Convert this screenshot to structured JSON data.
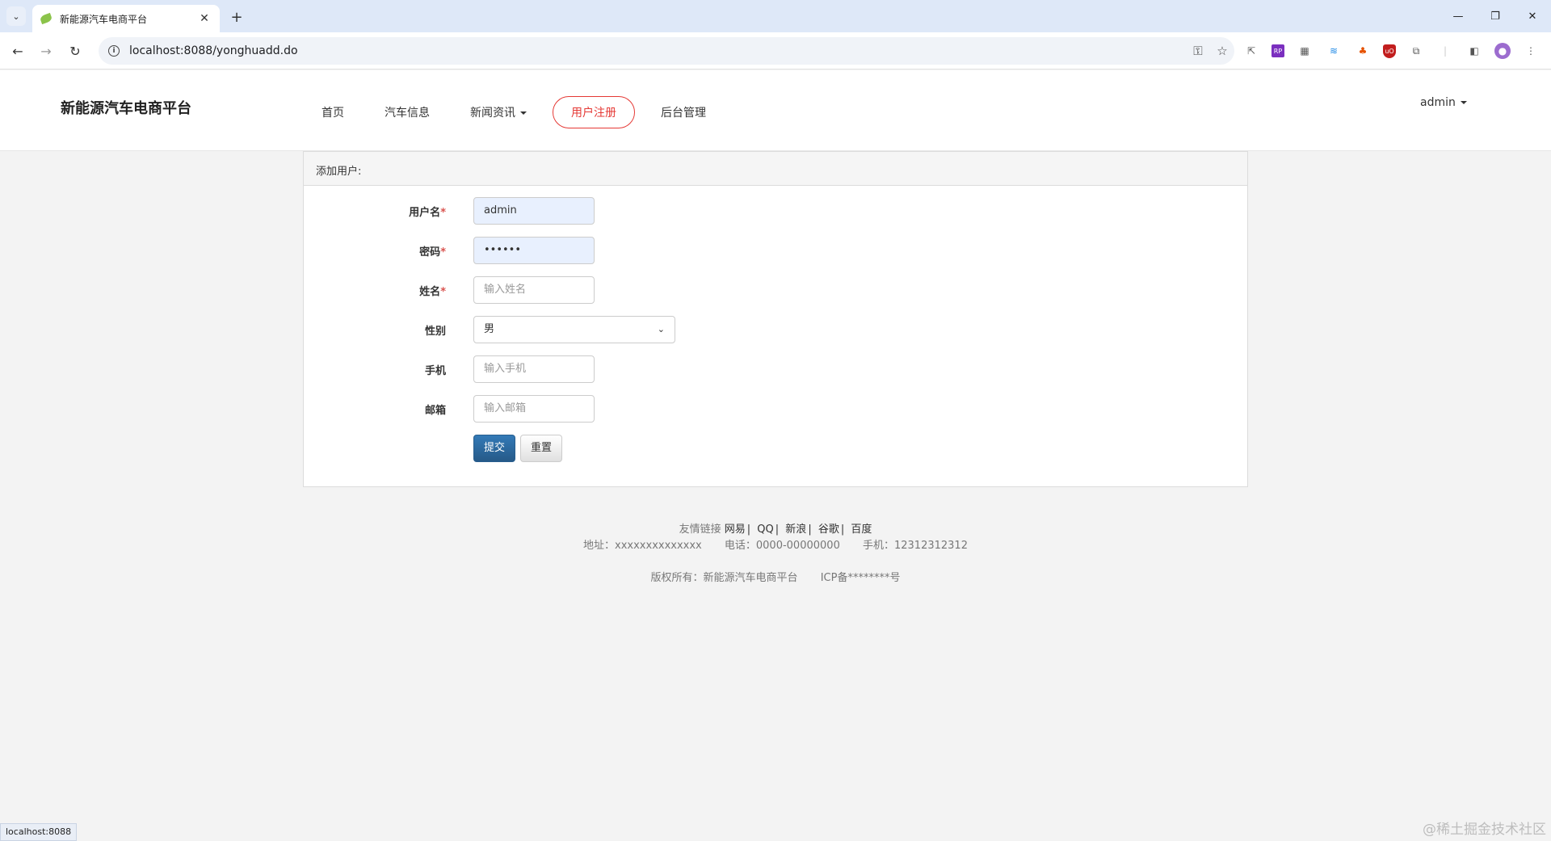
{
  "browser": {
    "tab_title": "新能源汽车电商平台",
    "url": "localhost:8088/yonghuadd.do",
    "status_url": "localhost:8088"
  },
  "site": {
    "brand": "新能源汽车电商平台",
    "nav": {
      "home": "首页",
      "cars": "汽车信息",
      "news": "新闻资讯",
      "register": "用户注册",
      "admin": "后台管理"
    },
    "user_menu": "admin"
  },
  "form": {
    "heading": "添加用户:",
    "username": {
      "label": "用户名",
      "value": "admin"
    },
    "password": {
      "label": "密码",
      "value": "••••••"
    },
    "name": {
      "label": "姓名",
      "placeholder": "输入姓名"
    },
    "gender": {
      "label": "性别",
      "selected": "男"
    },
    "phone": {
      "label": "手机",
      "placeholder": "输入手机"
    },
    "email": {
      "label": "邮箱",
      "placeholder": "输入邮箱"
    },
    "required_mark": "*",
    "submit": "提交",
    "reset": "重置"
  },
  "footer": {
    "links_label": "友情链接",
    "links": [
      "网易",
      "QQ",
      "新浪",
      "谷歌",
      "百度"
    ],
    "separator": "|",
    "address": "地址：xxxxxxxxxxxxxx",
    "tel": "电话：0000-00000000",
    "mobile": "手机：12312312312",
    "copyright": "版权所有：新能源汽车电商平台",
    "icp": "ICP备********号"
  },
  "watermark": "@稀土掘金技术社区"
}
